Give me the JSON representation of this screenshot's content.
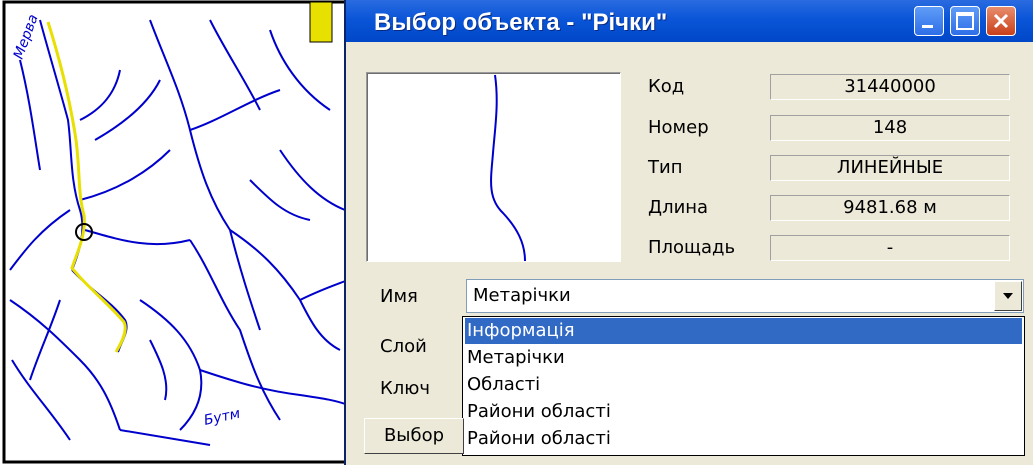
{
  "dialog": {
    "title": "Выбор объекта - \"Річки\"",
    "fields": [
      {
        "label": "Код",
        "value": "31440000"
      },
      {
        "label": "Номер",
        "value": "148"
      },
      {
        "label": "Тип",
        "value": "ЛИНЕЙНЫЕ"
      },
      {
        "label": "Длина",
        "value": "9481.68  м"
      },
      {
        "label": "Площадь",
        "value": "-"
      }
    ],
    "name_label": "Имя",
    "layer_label": "Слой",
    "key_label": "Ключ",
    "name_value": "Метарічки",
    "dropdown_options": [
      "Інформація",
      "Метарічки",
      "Області",
      "Райони області",
      "Райони області"
    ],
    "selected_option": "Інформація",
    "select_button": "Выбор"
  },
  "map": {
    "labels": [
      "Мерва",
      "Бутм"
    ],
    "colors": {
      "rivers": "#0000cc",
      "highlight": "#e8e000",
      "border": "#000000"
    }
  },
  "titlebar_controls": [
    "minimize-icon",
    "maximize-icon",
    "close-icon"
  ]
}
